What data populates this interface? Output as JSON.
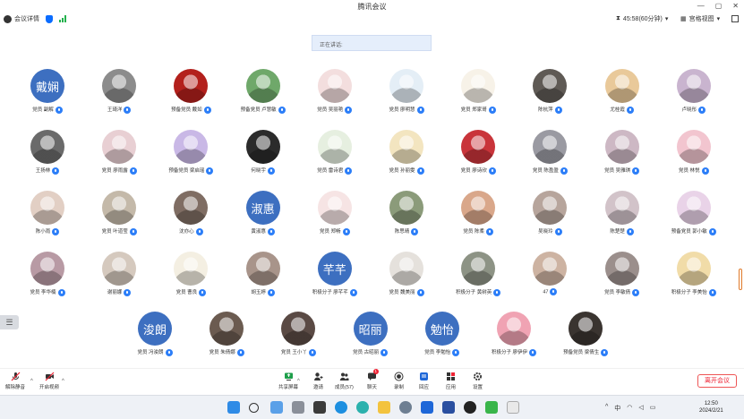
{
  "window": {
    "title": "腾讯会议",
    "controls": [
      "—",
      "▢",
      "✕"
    ]
  },
  "header": {
    "meeting_details": "会议详情",
    "timer": "45:58(60分钟)",
    "view_mode": "宫格视图"
  },
  "speaking": {
    "label": "正在讲话:"
  },
  "participants": [
    {
      "name": "党员 副解",
      "avatar_text": "戴娴",
      "color": "#3d6fc0"
    },
    {
      "name": "王琦洋",
      "avatar_text": "",
      "color": "#8c8c8c"
    },
    {
      "name": "预备党员 戴如",
      "avatar_text": "",
      "color": "#b3201c"
    },
    {
      "name": "预备党员 卢慧敏",
      "avatar_text": "",
      "color": "#6fa86a"
    },
    {
      "name": "党员 吴丽艳",
      "avatar_text": "",
      "color": "#f3dede"
    },
    {
      "name": "党员 廖明慧",
      "avatar_text": "",
      "color": "#e4eef6"
    },
    {
      "name": "党员 郑家哥",
      "avatar_text": "",
      "color": "#f7f2e8"
    },
    {
      "name": "陈杭萍",
      "avatar_text": "",
      "color": "#5f5a55"
    },
    {
      "name": "尤桂霞",
      "avatar_text": "",
      "color": "#e9c99a"
    },
    {
      "name": "卢晓彤",
      "avatar_text": "",
      "color": "#c9b4cf"
    },
    {
      "name": "王扬林",
      "avatar_text": "",
      "color": "#6a6a6a"
    },
    {
      "name": "党员 廖雨露",
      "avatar_text": "",
      "color": "#e8cfd3"
    },
    {
      "name": "预备党员 梁启瑶",
      "avatar_text": "",
      "color": "#c9b8e6"
    },
    {
      "name": "何晓宇",
      "avatar_text": "",
      "color": "#2b2b2b"
    },
    {
      "name": "党员 雷诗君",
      "avatar_text": "",
      "color": "#e6efe0"
    },
    {
      "name": "党员 孙丽雯",
      "avatar_text": "",
      "color": "#f3e5c0"
    },
    {
      "name": "党员 廖诗欣",
      "avatar_text": "",
      "color": "#c9343a"
    },
    {
      "name": "党员 陈盈盈",
      "avatar_text": "",
      "color": "#9a9aa2"
    },
    {
      "name": "党员 吴雅琪",
      "avatar_text": "",
      "color": "#cdb8c4"
    },
    {
      "name": "党员 林悦",
      "avatar_text": "",
      "color": "#f2c5cf"
    },
    {
      "name": "陈小雨",
      "avatar_text": "",
      "color": "#e2cfc4"
    },
    {
      "name": "党员 叶道莹",
      "avatar_text": "",
      "color": "#c4b9a9"
    },
    {
      "name": "沈亦心",
      "avatar_text": "",
      "color": "#7f6d63"
    },
    {
      "name": "黄淑惠",
      "avatar_text": "淑惠",
      "color": "#3d6fc0"
    },
    {
      "name": "党员 郑畅",
      "avatar_text": "",
      "color": "#f6e4e4"
    },
    {
      "name": "陈思晴",
      "avatar_text": "",
      "color": "#8b9b7a"
    },
    {
      "name": "党员 陈柔",
      "avatar_text": "",
      "color": "#d9a78a"
    },
    {
      "name": "吴晓玲",
      "avatar_text": "",
      "color": "#b7a59c"
    },
    {
      "name": "陈楚楚",
      "avatar_text": "",
      "color": "#d2c3c9"
    },
    {
      "name": "预备党员 郭小敏",
      "avatar_text": "",
      "color": "#e9d3e8"
    },
    {
      "name": "党员 李华楠",
      "avatar_text": "",
      "color": "#b89aa4"
    },
    {
      "name": "谢丽娜",
      "avatar_text": "",
      "color": "#d5c9be"
    },
    {
      "name": "党员 曹良",
      "avatar_text": "",
      "color": "#f4efe2"
    },
    {
      "name": "胡玉婷",
      "avatar_text": "",
      "color": "#a8948a"
    },
    {
      "name": "积极分子 廖芊芊",
      "avatar_text": "芊芊",
      "color": "#3d6fc0"
    },
    {
      "name": "党员 魏美丽",
      "avatar_text": "",
      "color": "#e5e1dc"
    },
    {
      "name": "积极分子 黄树英",
      "avatar_text": "",
      "color": "#8d9385"
    },
    {
      "name": "47",
      "avatar_text": "",
      "color": "#cdb3a2"
    },
    {
      "name": "党员 李敏倩",
      "avatar_text": "",
      "color": "#9b8f8c"
    },
    {
      "name": "积极分子 李美怡",
      "avatar_text": "",
      "color": "#f1dca8"
    },
    {
      "name": "党员 冯浚朗",
      "avatar_text": "浚朗",
      "color": "#3d6fc0"
    },
    {
      "name": "党员 朱倩娜",
      "avatar_text": "",
      "color": "#6b5b50"
    },
    {
      "name": "党员 王小丫",
      "avatar_text": "",
      "color": "#5a4a44"
    },
    {
      "name": "党员 古昭丽",
      "avatar_text": "昭丽",
      "color": "#3d6fc0"
    },
    {
      "name": "党员 李勉怡",
      "avatar_text": "勉怡",
      "color": "#3d6fc0"
    },
    {
      "name": "积极分子 廖伊伊",
      "avatar_text": "",
      "color": "#f0a3b3"
    },
    {
      "name": "预备党员 梁倩生",
      "avatar_text": "",
      "color": "#3a3430"
    }
  ],
  "toolbar": {
    "mute": "解除静音",
    "video": "开启视频",
    "share": "共享屏幕",
    "invite": "邀请",
    "members": "成员(57)",
    "chat": "聊天",
    "chat_badge": "1",
    "record": "录制",
    "apps_icon": "回应",
    "apps": "应用",
    "settings": "设置",
    "leave": "离开会议"
  },
  "taskbar": {
    "time": "12:50",
    "date": "2024/2/21",
    "lang": "中"
  }
}
